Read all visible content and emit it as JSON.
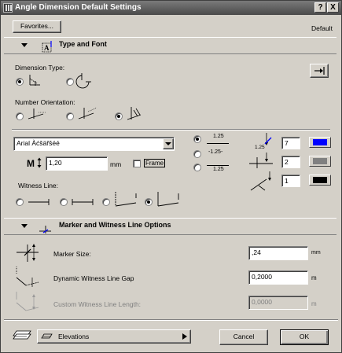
{
  "window": {
    "title": "Angle Dimension Default Settings",
    "help_label": "?",
    "close_label": "X"
  },
  "header": {
    "favorites_label": "Favorites...",
    "default_label": "Default"
  },
  "type_font": {
    "title": "Type and Font",
    "dimension_type_label": "Dimension Type:",
    "number_orientation_label": "Number Orientation:",
    "font_name": "Arial Àćšäřšéé",
    "text_size": "1,20",
    "text_unit": "mm",
    "frame_label": "Frame",
    "witness_line_label": "Witness Line:",
    "pen_values": [
      "7",
      "2",
      "1"
    ],
    "pen_colors": [
      "#0000ff",
      "#808080",
      "#000000"
    ],
    "sample_numbers": [
      "1.25",
      "-1.25-",
      "1.25"
    ]
  },
  "marker_panel": {
    "title": "Marker and Witness Line Options",
    "marker_size_label": "Marker Size:",
    "marker_size_value": ",24",
    "marker_size_unit": "mm",
    "gap_label": "Dynamic Witness Line Gap",
    "gap_value": "0,2000",
    "gap_unit": "m",
    "custom_length_label": "Custom Witness Line Length:",
    "custom_length_value": "0,0000",
    "custom_length_unit": "m"
  },
  "footer": {
    "layer_value": "Elevations",
    "cancel_label": "Cancel",
    "ok_label": "OK"
  }
}
